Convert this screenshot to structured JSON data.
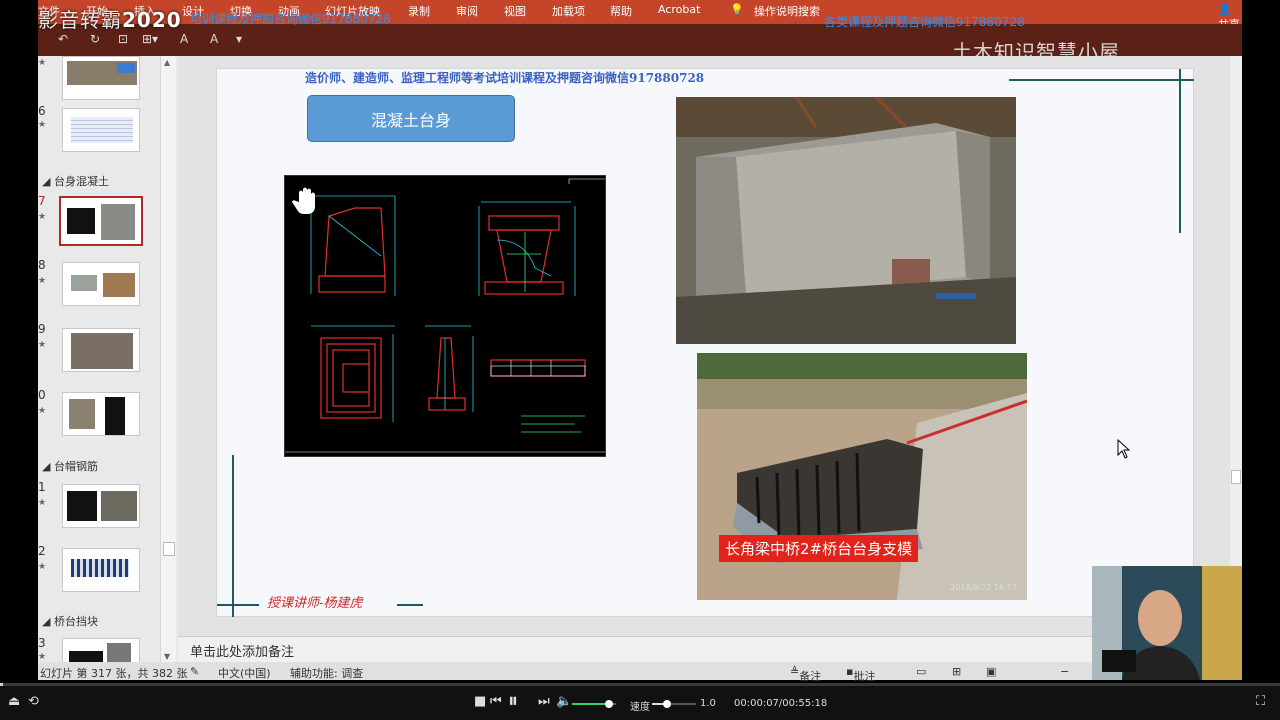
{
  "player": {
    "logo_text": "影音转霸",
    "logo_year": "2020",
    "speed_label": "速度",
    "speed_value": "1.0",
    "speed_fraction": 0.35,
    "volume_fraction": 0.85,
    "time": "00:00:07/00:55:18",
    "progress_fraction": 0.002
  },
  "ribbon": {
    "tabs": [
      "文件",
      "开始",
      "插入",
      "设计",
      "切换",
      "动画",
      "幻灯片放映",
      "录制",
      "审阅",
      "视图",
      "加载项",
      "帮助",
      "Acrobat",
      "操作说明搜索"
    ],
    "share": "共享"
  },
  "watermarks": {
    "blue_left": "培训课程及押题咨询微信917880728",
    "blue_right": "各类课程及押题咨询微信917880728",
    "right_title": "土木知识智慧小屋"
  },
  "slide_pane": {
    "sections": [
      "台身混凝土",
      "台帽钢筋",
      "桥台挡块"
    ],
    "slides": [
      {
        "num": "",
        "star": "★"
      },
      {
        "num": "6",
        "star": "★"
      },
      {
        "num": "7",
        "star": "★"
      },
      {
        "num": "8",
        "star": "★"
      },
      {
        "num": "9",
        "star": "★"
      },
      {
        "num": "0",
        "star": "★"
      },
      {
        "num": "1",
        "star": "★"
      },
      {
        "num": "2",
        "star": "★"
      },
      {
        "num": "3",
        "star": "★"
      }
    ]
  },
  "slide": {
    "header_text": "造价师、建造师、监理工程师等考试培训课程及押题咨询微信917880728",
    "title": "混凝土台身",
    "photo2_caption": "长角梁中桥2#桥台台身支模",
    "photo2_date": "2018/9/22  16:57",
    "lecturer": "授课讲师-杨建虎"
  },
  "notes": {
    "placeholder": "单击此处添加备注"
  },
  "status": {
    "slide_count": "幻灯片 第 317 张，共 382 张",
    "language": "中文(中国)",
    "accessibility": "辅助功能: 调查",
    "notes_btn": "备注",
    "comments_btn": "批注"
  },
  "colors": {
    "ribbon_red": "#c4452a",
    "title_box_blue": "#5b9bd5",
    "caption_red": "#e2231a",
    "header_blue": "#3a62c4"
  }
}
